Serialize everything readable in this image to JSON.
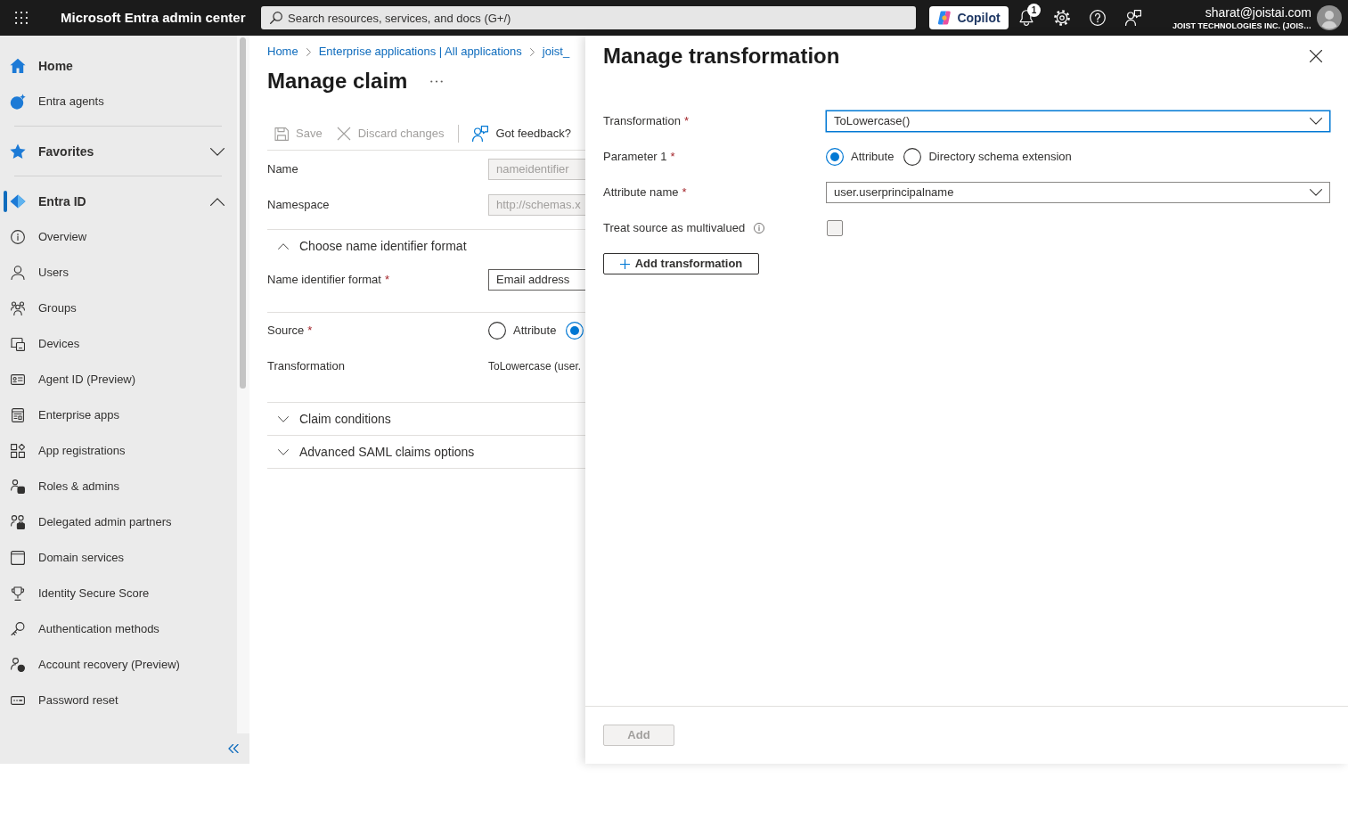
{
  "top_bar": {
    "title": "Microsoft Entra admin center",
    "search": {
      "placeholder": "Search resources, services, and docs (G+/)"
    },
    "copilot": "Copilot",
    "notifications": "1",
    "user": {
      "email": "sharat@joistai.com",
      "tenant": "JOIST TECHNOLOGIES INC. (JOIS…"
    }
  },
  "sidebar": {
    "items": [
      {
        "kind": "main",
        "label": "Home",
        "selected": false
      },
      {
        "kind": "link",
        "label": "Entra agents",
        "selected": false
      },
      {
        "kind": "group",
        "label": "Favorites",
        "selected": false,
        "expanded": false
      },
      {
        "kind": "group",
        "label": "Entra ID",
        "selected": true,
        "expanded": true,
        "children": [
          {
            "label": "Overview",
            "selected": false
          },
          {
            "label": "Users",
            "selected": false
          },
          {
            "label": "Groups",
            "selected": false
          },
          {
            "label": "Devices",
            "selected": false
          },
          {
            "label": "Agent ID (Preview)",
            "selected": false
          },
          {
            "label": "Enterprise apps",
            "selected": false
          },
          {
            "label": "App registrations",
            "selected": false
          },
          {
            "label": "Roles & admins",
            "selected": false
          },
          {
            "label": "Delegated admin partners",
            "selected": false
          },
          {
            "label": "Domain services",
            "selected": false
          },
          {
            "label": "Identity Secure Score",
            "selected": false
          },
          {
            "label": "Authentication methods",
            "selected": false
          },
          {
            "label": "Account recovery (Preview)",
            "selected": false
          },
          {
            "label": "Password reset",
            "selected": false
          }
        ]
      }
    ]
  },
  "blade": {
    "breadcrumb": [
      "Home",
      "Enterprise applications | All applications",
      "joist_"
    ],
    "title": "Manage claim",
    "toolbar": {
      "actions": [
        {
          "label": "Save",
          "disabled": true
        },
        {
          "label": "Discard changes",
          "disabled": true
        }
      ],
      "feedback": "Got feedback?"
    },
    "rows": [
      {
        "kind": "field",
        "label": "Name",
        "value": "nameidentifier",
        "disabled": true
      },
      {
        "kind": "field",
        "label": "Namespace",
        "value": "http://schemas.x",
        "disabled": true
      },
      {
        "kind": "section",
        "label": "Choose name identifier format",
        "expanded": true,
        "children": [
          {
            "kind": "field",
            "label": "Name identifier format",
            "required_mark": "*",
            "value": "Email address",
            "disabled": false
          }
        ]
      },
      {
        "kind": "radio",
        "label": "Source",
        "required_mark": "*",
        "options": [
          {
            "label": "Attribute",
            "selected": false
          },
          {
            "selected": true
          }
        ]
      },
      {
        "kind": "text",
        "label": "Transformation",
        "value": "ToLowercase (user."
      },
      {
        "kind": "section",
        "label": "Claim conditions",
        "expanded": false
      },
      {
        "kind": "section",
        "label": "Advanced SAML claims options",
        "expanded": false
      }
    ]
  },
  "panel": {
    "title": "Manage transformation",
    "fields": [
      {
        "kind": "dropdown",
        "label": "Transformation",
        "required_mark": "*",
        "value": "ToLowercase()",
        "focused": true
      },
      {
        "kind": "radio",
        "label": "Parameter 1",
        "required_mark": "*",
        "options": [
          {
            "label": "Attribute",
            "selected": true
          },
          {
            "label": "Directory schema extension",
            "selected": false
          }
        ]
      },
      {
        "kind": "dropdown",
        "label": "Attribute name",
        "required_mark": "*",
        "value": "user.userprincipalname",
        "focused": false
      },
      {
        "kind": "checkbox",
        "label": "Treat source as multivalued",
        "info": true,
        "checked": false
      }
    ],
    "add_transformation": "Add transformation",
    "submit": {
      "label": "Add",
      "disabled": true
    }
  }
}
